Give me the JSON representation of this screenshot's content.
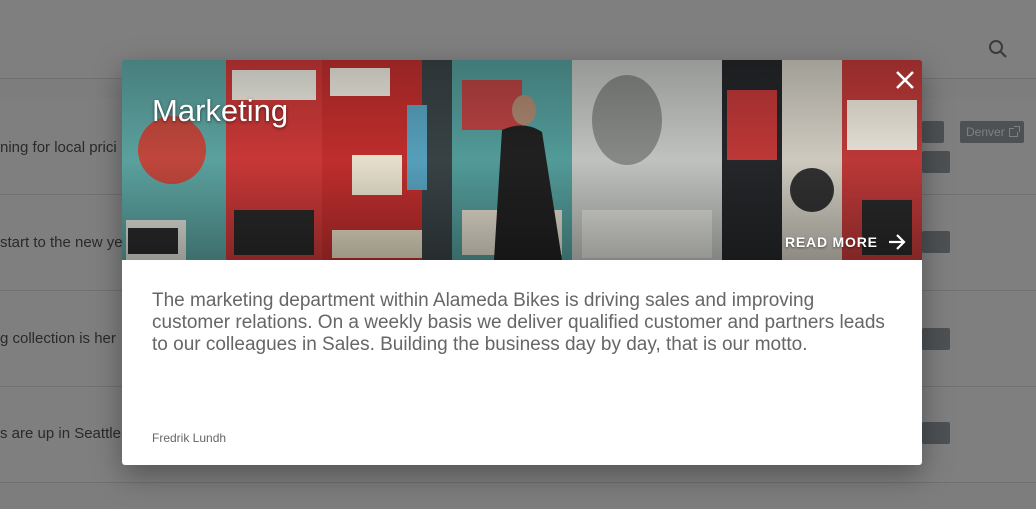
{
  "background": {
    "rows": [
      {
        "text": "ning for local prici",
        "chips": [
          "Denver"
        ]
      },
      {
        "text": "start to the new ye",
        "chips": []
      },
      {
        "text": "g collection is her",
        "chips": []
      },
      {
        "text": "s are up in Seattle",
        "chips": []
      }
    ]
  },
  "modal": {
    "title": "Marketing",
    "read_more": "READ MORE",
    "body": "The marketing department within Alameda Bikes is driving sales and improving customer relations. On a weekly basis we deliver qualified customer and partners leads to our colleagues in Sales. Building the business day by day, that is our motto.",
    "author": "Fredrik Lundh"
  },
  "colors": {
    "overlay": "rgba(0,0,0,0.5)",
    "chip": "#9aa2a8",
    "body_text": "#666666"
  },
  "icons": [
    "search-icon",
    "close-icon",
    "arrow-right-icon",
    "external-link-icon"
  ]
}
